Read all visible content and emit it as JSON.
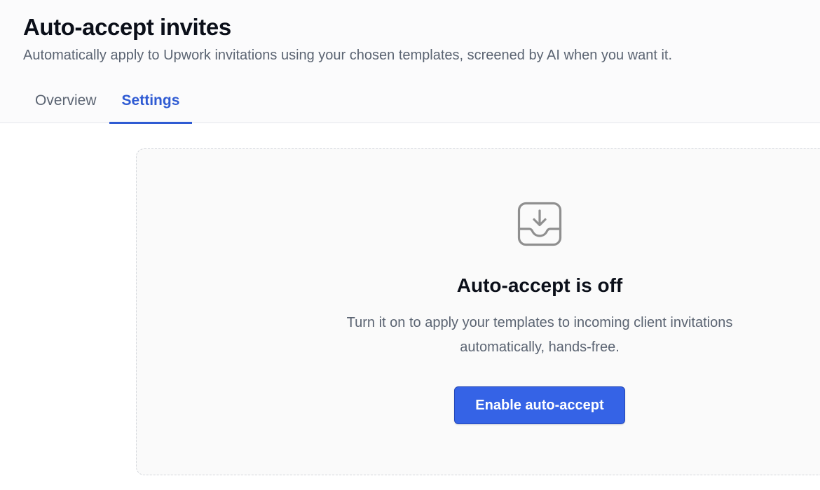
{
  "header": {
    "title": "Auto-accept invites",
    "subtitle": "Automatically apply to Upwork invitations using your chosen templates, screened by AI when you want it."
  },
  "tabs": [
    {
      "label": "Overview",
      "active": false
    },
    {
      "label": "Settings",
      "active": true
    }
  ],
  "empty_state": {
    "icon": "inbox-download-icon",
    "title": "Auto-accept is off",
    "description": "Turn it on to apply your templates to incoming client invitations automatically, hands-free.",
    "button_label": "Enable auto-accept"
  },
  "colors": {
    "accent": "#3563e6",
    "active_tab": "#2f5bd3",
    "muted_text": "#5b6472",
    "icon": "#8f8f8f"
  }
}
